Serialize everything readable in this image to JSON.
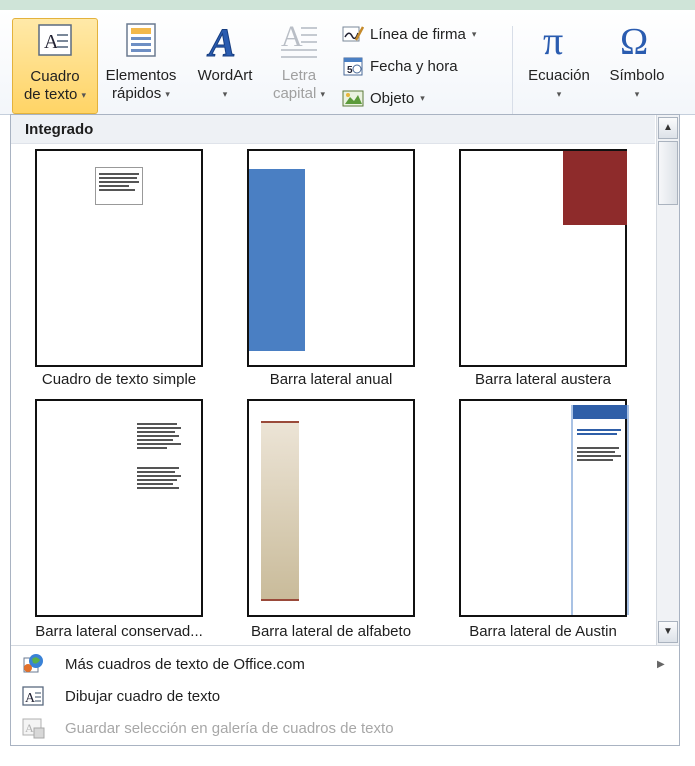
{
  "ribbon": {
    "cuadro_texto": {
      "line1": "Cuadro",
      "line2": "de texto"
    },
    "elementos_rapidos": {
      "line1": "Elementos",
      "line2": "rápidos"
    },
    "wordart": {
      "label": "WordArt"
    },
    "letra_capital": {
      "line1": "Letra",
      "line2": "capital"
    },
    "linea_firma": {
      "label": "Línea de firma"
    },
    "fecha_hora": {
      "label": "Fecha y hora"
    },
    "objeto": {
      "label": "Objeto"
    },
    "ecuacion": {
      "label": "Ecuación"
    },
    "simbolo": {
      "label": "Símbolo"
    },
    "dropdown_arrow": "▾"
  },
  "gallery": {
    "heading": "Integrado",
    "items": [
      {
        "label": "Cuadro de texto simple"
      },
      {
        "label": "Barra lateral anual"
      },
      {
        "label": "Barra lateral austera"
      },
      {
        "label": "Barra lateral conservad..."
      },
      {
        "label": "Barra lateral de alfabeto"
      },
      {
        "label": "Barra lateral de Austin"
      }
    ]
  },
  "menu": {
    "mas_cuadros": "Más cuadros de texto de Office.com",
    "dibujar": "Dibujar cuadro de texto",
    "guardar": "Guardar selección en galería de cuadros de texto",
    "submenu_arrow": "▶"
  },
  "scroll": {
    "up": "▲",
    "down": "▼"
  },
  "colors": {
    "accent_blue": "#4a7fc3",
    "accent_red": "#8e2b2b",
    "active": "#ffd466"
  }
}
